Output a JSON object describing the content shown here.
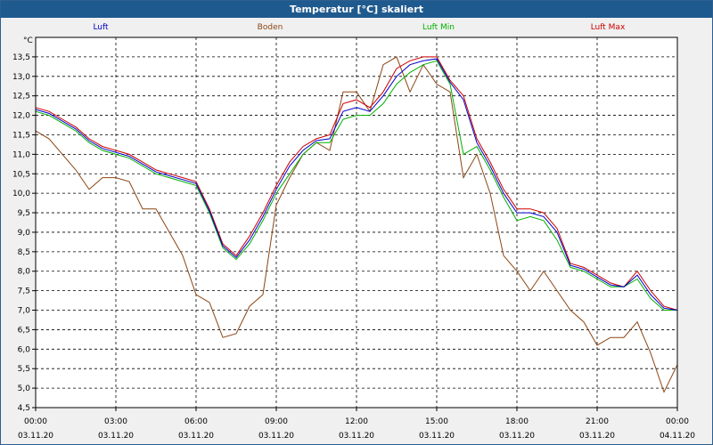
{
  "title": "Temperatur [°C] skaliert",
  "unit": "°C",
  "legend": [
    {
      "name": "Luft",
      "color": "#0000cc"
    },
    {
      "name": "Boden",
      "color": "#8b4513"
    },
    {
      "name": "Luft Min",
      "color": "#00b000"
    },
    {
      "name": "Luft Max",
      "color": "#cc0000"
    }
  ],
  "chart_data": {
    "type": "line",
    "title": "Temperatur [°C] skaliert",
    "ylabel": "°C",
    "ylim": [
      4.5,
      14.0
    ],
    "xlim": [
      0,
      24
    ],
    "grid": true,
    "legend_position": "top",
    "y_ticks": [
      "4,5",
      "5,0",
      "5,5",
      "6,0",
      "6,5",
      "7,0",
      "7,5",
      "8,0",
      "8,5",
      "9,0",
      "9,5",
      "10,0",
      "10,5",
      "11,0",
      "11,5",
      "12,0",
      "12,5",
      "13,0",
      "13,5"
    ],
    "y_tick_values": [
      4.5,
      5.0,
      5.5,
      6.0,
      6.5,
      7.0,
      7.5,
      8.0,
      8.5,
      9.0,
      9.5,
      10.0,
      10.5,
      11.0,
      11.5,
      12.0,
      12.5,
      13.0,
      13.5
    ],
    "x_ticks": [
      {
        "time": "00:00",
        "date": "03.11.20"
      },
      {
        "time": "03:00",
        "date": "03.11.20"
      },
      {
        "time": "06:00",
        "date": "03.11.20"
      },
      {
        "time": "09:00",
        "date": "03.11.20"
      },
      {
        "time": "12:00",
        "date": "03.11.20"
      },
      {
        "time": "15:00",
        "date": "03.11.20"
      },
      {
        "time": "18:00",
        "date": "03.11.20"
      },
      {
        "time": "21:00",
        "date": "03.11.20"
      },
      {
        "time": "00:00",
        "date": "04.11.20"
      }
    ],
    "series": [
      {
        "name": "Boden",
        "color": "#8b4513",
        "x": [
          0,
          0.5,
          1,
          1.5,
          2,
          2.5,
          3,
          3.5,
          4,
          4.5,
          5,
          5.5,
          6,
          6.5,
          7,
          7.5,
          8,
          8.5,
          9,
          9.5,
          10,
          10.5,
          11,
          11.5,
          12,
          12.5,
          13,
          13.5,
          14,
          14.5,
          15,
          15.5,
          16,
          16.5,
          17,
          17.5,
          18,
          18.5,
          19,
          19.5,
          20,
          20.5,
          21,
          21.5,
          22,
          22.5,
          23,
          23.5,
          24
        ],
        "values": [
          11.6,
          11.4,
          11.0,
          10.6,
          10.1,
          10.4,
          10.4,
          10.3,
          9.6,
          9.6,
          9.0,
          8.4,
          7.4,
          7.2,
          6.3,
          6.4,
          7.1,
          7.4,
          9.7,
          10.4,
          11.0,
          11.3,
          11.1,
          12.6,
          12.6,
          12.1,
          13.3,
          13.5,
          12.6,
          13.3,
          12.8,
          12.6,
          10.4,
          11.0,
          10.0,
          8.4,
          8.0,
          7.5,
          8.0,
          7.5,
          7.0,
          6.7,
          6.1,
          6.3,
          6.3,
          6.7,
          5.9,
          4.9,
          5.6
        ]
      },
      {
        "name": "Luft Min",
        "color": "#00b000",
        "x": [
          0,
          0.5,
          1,
          1.5,
          2,
          2.5,
          3,
          3.5,
          4,
          4.5,
          5,
          5.5,
          6,
          6.5,
          7,
          7.5,
          8,
          8.5,
          9,
          9.5,
          10,
          10.5,
          11,
          11.5,
          12,
          12.5,
          13,
          13.5,
          14,
          14.5,
          15,
          15.5,
          16,
          16.5,
          17,
          17.5,
          18,
          18.5,
          19,
          19.5,
          20,
          20.5,
          21,
          21.5,
          22,
          22.5,
          23,
          23.5,
          24
        ],
        "values": [
          12.1,
          12.0,
          11.8,
          11.6,
          11.3,
          11.1,
          11.0,
          10.9,
          10.7,
          10.5,
          10.4,
          10.3,
          10.2,
          9.5,
          8.6,
          8.3,
          8.7,
          9.3,
          10.0,
          10.5,
          11.0,
          11.3,
          11.3,
          11.9,
          12.0,
          12.0,
          12.3,
          12.8,
          13.1,
          13.3,
          13.4,
          12.8,
          11.0,
          11.2,
          10.6,
          9.9,
          9.3,
          9.4,
          9.3,
          8.8,
          8.1,
          8.0,
          7.8,
          7.6,
          7.6,
          7.8,
          7.3,
          7.0,
          7.0
        ]
      },
      {
        "name": "Luft Max",
        "color": "#cc0000",
        "x": [
          0,
          0.5,
          1,
          1.5,
          2,
          2.5,
          3,
          3.5,
          4,
          4.5,
          5,
          5.5,
          6,
          6.5,
          7,
          7.5,
          8,
          8.5,
          9,
          9.5,
          10,
          10.5,
          11,
          11.5,
          12,
          12.5,
          13,
          13.5,
          14,
          14.5,
          15,
          15.5,
          16,
          16.5,
          17,
          17.5,
          18,
          18.5,
          19,
          19.5,
          20,
          20.5,
          21,
          21.5,
          22,
          22.5,
          23,
          23.5,
          24
        ],
        "values": [
          12.2,
          12.1,
          11.9,
          11.7,
          11.4,
          11.2,
          11.1,
          11.0,
          10.8,
          10.6,
          10.5,
          10.4,
          10.3,
          9.6,
          8.7,
          8.4,
          8.9,
          9.5,
          10.2,
          10.8,
          11.2,
          11.4,
          11.5,
          12.3,
          12.4,
          12.2,
          12.6,
          13.2,
          13.4,
          13.5,
          13.5,
          12.9,
          12.5,
          11.4,
          10.8,
          10.1,
          9.6,
          9.6,
          9.5,
          9.1,
          8.2,
          8.1,
          7.9,
          7.7,
          7.6,
          8.0,
          7.5,
          7.1,
          7.0
        ]
      },
      {
        "name": "Luft",
        "color": "#0000cc",
        "x": [
          0,
          0.5,
          1,
          1.5,
          2,
          2.5,
          3,
          3.5,
          4,
          4.5,
          5,
          5.5,
          6,
          6.5,
          7,
          7.5,
          8,
          8.5,
          9,
          9.5,
          10,
          10.5,
          11,
          11.5,
          12,
          12.5,
          13,
          13.5,
          14,
          14.5,
          15,
          15.5,
          16,
          16.5,
          17,
          17.5,
          18,
          18.5,
          19,
          19.5,
          20,
          20.5,
          21,
          21.5,
          22,
          22.5,
          23,
          23.5,
          24
        ],
        "values": [
          12.15,
          12.05,
          11.85,
          11.65,
          11.35,
          11.15,
          11.05,
          10.95,
          10.75,
          10.55,
          10.45,
          10.35,
          10.25,
          9.55,
          8.65,
          8.35,
          8.8,
          9.4,
          10.1,
          10.7,
          11.1,
          11.35,
          11.4,
          12.1,
          12.2,
          12.1,
          12.5,
          13.0,
          13.3,
          13.4,
          13.45,
          12.85,
          12.4,
          11.3,
          10.7,
          10.0,
          9.5,
          9.5,
          9.4,
          9.0,
          8.15,
          8.05,
          7.85,
          7.65,
          7.6,
          7.9,
          7.4,
          7.05,
          7.0
        ]
      }
    ]
  }
}
